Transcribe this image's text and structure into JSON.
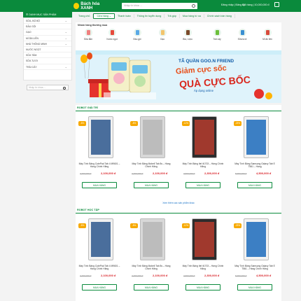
{
  "header": {
    "logo_text": "Bách hóa XANH",
    "search_placeholder": "Nhập từ khóa ...",
    "login": "Đăng nhập | Đăng ký",
    "cart": "Giỏ hàng | 10,000,000 đ"
  },
  "sidebar": {
    "title": "DANH MỤC SẢN PHẨM",
    "items": [
      {
        "label": "SỮA, BỘ BỘ",
        "has_sub": true
      },
      {
        "label": "ĐẦU GỘI",
        "has_sub": false
      },
      {
        "label": "GẠO",
        "has_sub": true
      },
      {
        "label": "MÌ ĂN LIỀN",
        "has_sub": true
      },
      {
        "label": "NHÀ THÔNG MINH",
        "has_sub": true
      },
      {
        "label": "NƯỚC NGỌT",
        "has_sub": false
      },
      {
        "label": "SỮA TẮM",
        "has_sub": false
      },
      {
        "label": "SỮA TƯƠI",
        "has_sub": false
      },
      {
        "label": "TRÁI CÂY",
        "has_sub": true
      }
    ],
    "search_placeholder": "Nhập từ khóa ..."
  },
  "nav": [
    {
      "label": "Trang chủ"
    },
    {
      "label": "Cửa hàng ⌄",
      "drop": true
    },
    {
      "label": "Thanh toán"
    },
    {
      "label": "Thông tin tuyển dụng"
    },
    {
      "label": "Trả góp"
    },
    {
      "label": "Mua hàng từ xa"
    },
    {
      "label": "Chính sách bán hàng"
    }
  ],
  "favorites": {
    "title": "Nhóm hàng thường mua",
    "items": [
      {
        "label": "Sữa tắm",
        "color": "#f08080"
      },
      {
        "label": "Nước ngọt",
        "color": "#e64a3b"
      },
      {
        "label": "Đầu gội",
        "color": "#5aa9e6"
      },
      {
        "label": "Gạo",
        "color": "#f2c46d"
      },
      {
        "label": "Bia, rượu",
        "color": "#7a4a2a"
      },
      {
        "label": "Trái cây",
        "color": "#6cbf3a"
      },
      {
        "label": "Sữa tươi",
        "color": "#3a8fd1"
      },
      {
        "label": "Mì ăn liền",
        "color": "#d84b3c"
      }
    ]
  },
  "banner": {
    "line1": "TÃ QUẦN GOO.N FRIEND",
    "line2": "Giảm cực sốc",
    "line3": "QUÀ CỰC BỐC",
    "line4": "Áp dụng online"
  },
  "sections": [
    {
      "title": "ROBOT GIẢI TRÍ",
      "more": "Xem thêm các sản phẩm khác",
      "products": [
        {
          "discount": "-8%",
          "name": "Máy Tính Bảng CutePad Tab 4 M9601 – Hàng Chính Hãng",
          "old": "2,290,000 đ",
          "new": "2,100,000 đ",
          "screen": "#4a6e9c",
          "frame": "#f0f0f0",
          "buy": "MUA HÀNG"
        },
        {
          "discount": "-8%",
          "name": "Máy Tính Bảng Mobell Tab 8s – Hàng Chính Hãng",
          "old": "2,290,000 đ",
          "new": "2,100,000 đ",
          "screen": "#bcbcbc",
          "frame": "#d8d8d8",
          "buy": "MUA HÀNG"
        },
        {
          "discount": "-12%",
          "name": "Máy Tính Bảng Itel it1703 – Hàng Chính Hãng",
          "old": "2,600,000 đ",
          "new": "2,300,000 đ",
          "screen": "#a0392d",
          "frame": "#2d2d2d",
          "buy": "MUA HÀNG"
        },
        {
          "discount": "-25%",
          "name": "Máy Tính Bảng Samsung Galaxy Tab E T561 – Hàng",
          "old": "5,990,000 đ",
          "new": "4,500,000 đ",
          "screen": "#3c7fc4",
          "frame": "#f2f2f2",
          "buy": "MUA HÀNG"
        }
      ]
    },
    {
      "title": "ROBOT HỌC TẬP",
      "more": "",
      "products": [
        {
          "discount": "-8%",
          "name": "Máy Tính Bảng CutePad Tab 4 M9601 – Hàng Chính Hãng",
          "old": "2,290,000 đ",
          "new": "2,100,000 đ",
          "screen": "#4a6e9c",
          "frame": "#f0f0f0",
          "buy": "MUA HÀNG"
        },
        {
          "discount": "-8%",
          "name": "Máy Tính Bảng Mobell Tab 8s – Hàng Chính Hãng",
          "old": "2,290,000 đ",
          "new": "2,100,000 đ",
          "screen": "#bcbcbc",
          "frame": "#d8d8d8",
          "buy": "MUA HÀNG"
        },
        {
          "discount": "-12%",
          "name": "Máy Tính Bảng Itel it1703 – Hàng Chính Hãng",
          "old": "2,600,000 đ",
          "new": "2,300,000 đ",
          "screen": "#a0392d",
          "frame": "#2d2d2d",
          "buy": "MUA HÀNG"
        },
        {
          "discount": "-25%",
          "name": "Máy Tính Bảng Samsung Galaxy Tab E T561 – Hàng Chính Hãng",
          "old": "5,990,000 đ",
          "new": "4,500,000 đ",
          "screen": "#3c7fc4",
          "frame": "#f2f2f2",
          "buy": "MUA HÀNG"
        }
      ]
    }
  ],
  "colors": {
    "brand": "#0a8a3c",
    "price": "#d81f26",
    "discount": "#f7a900"
  }
}
